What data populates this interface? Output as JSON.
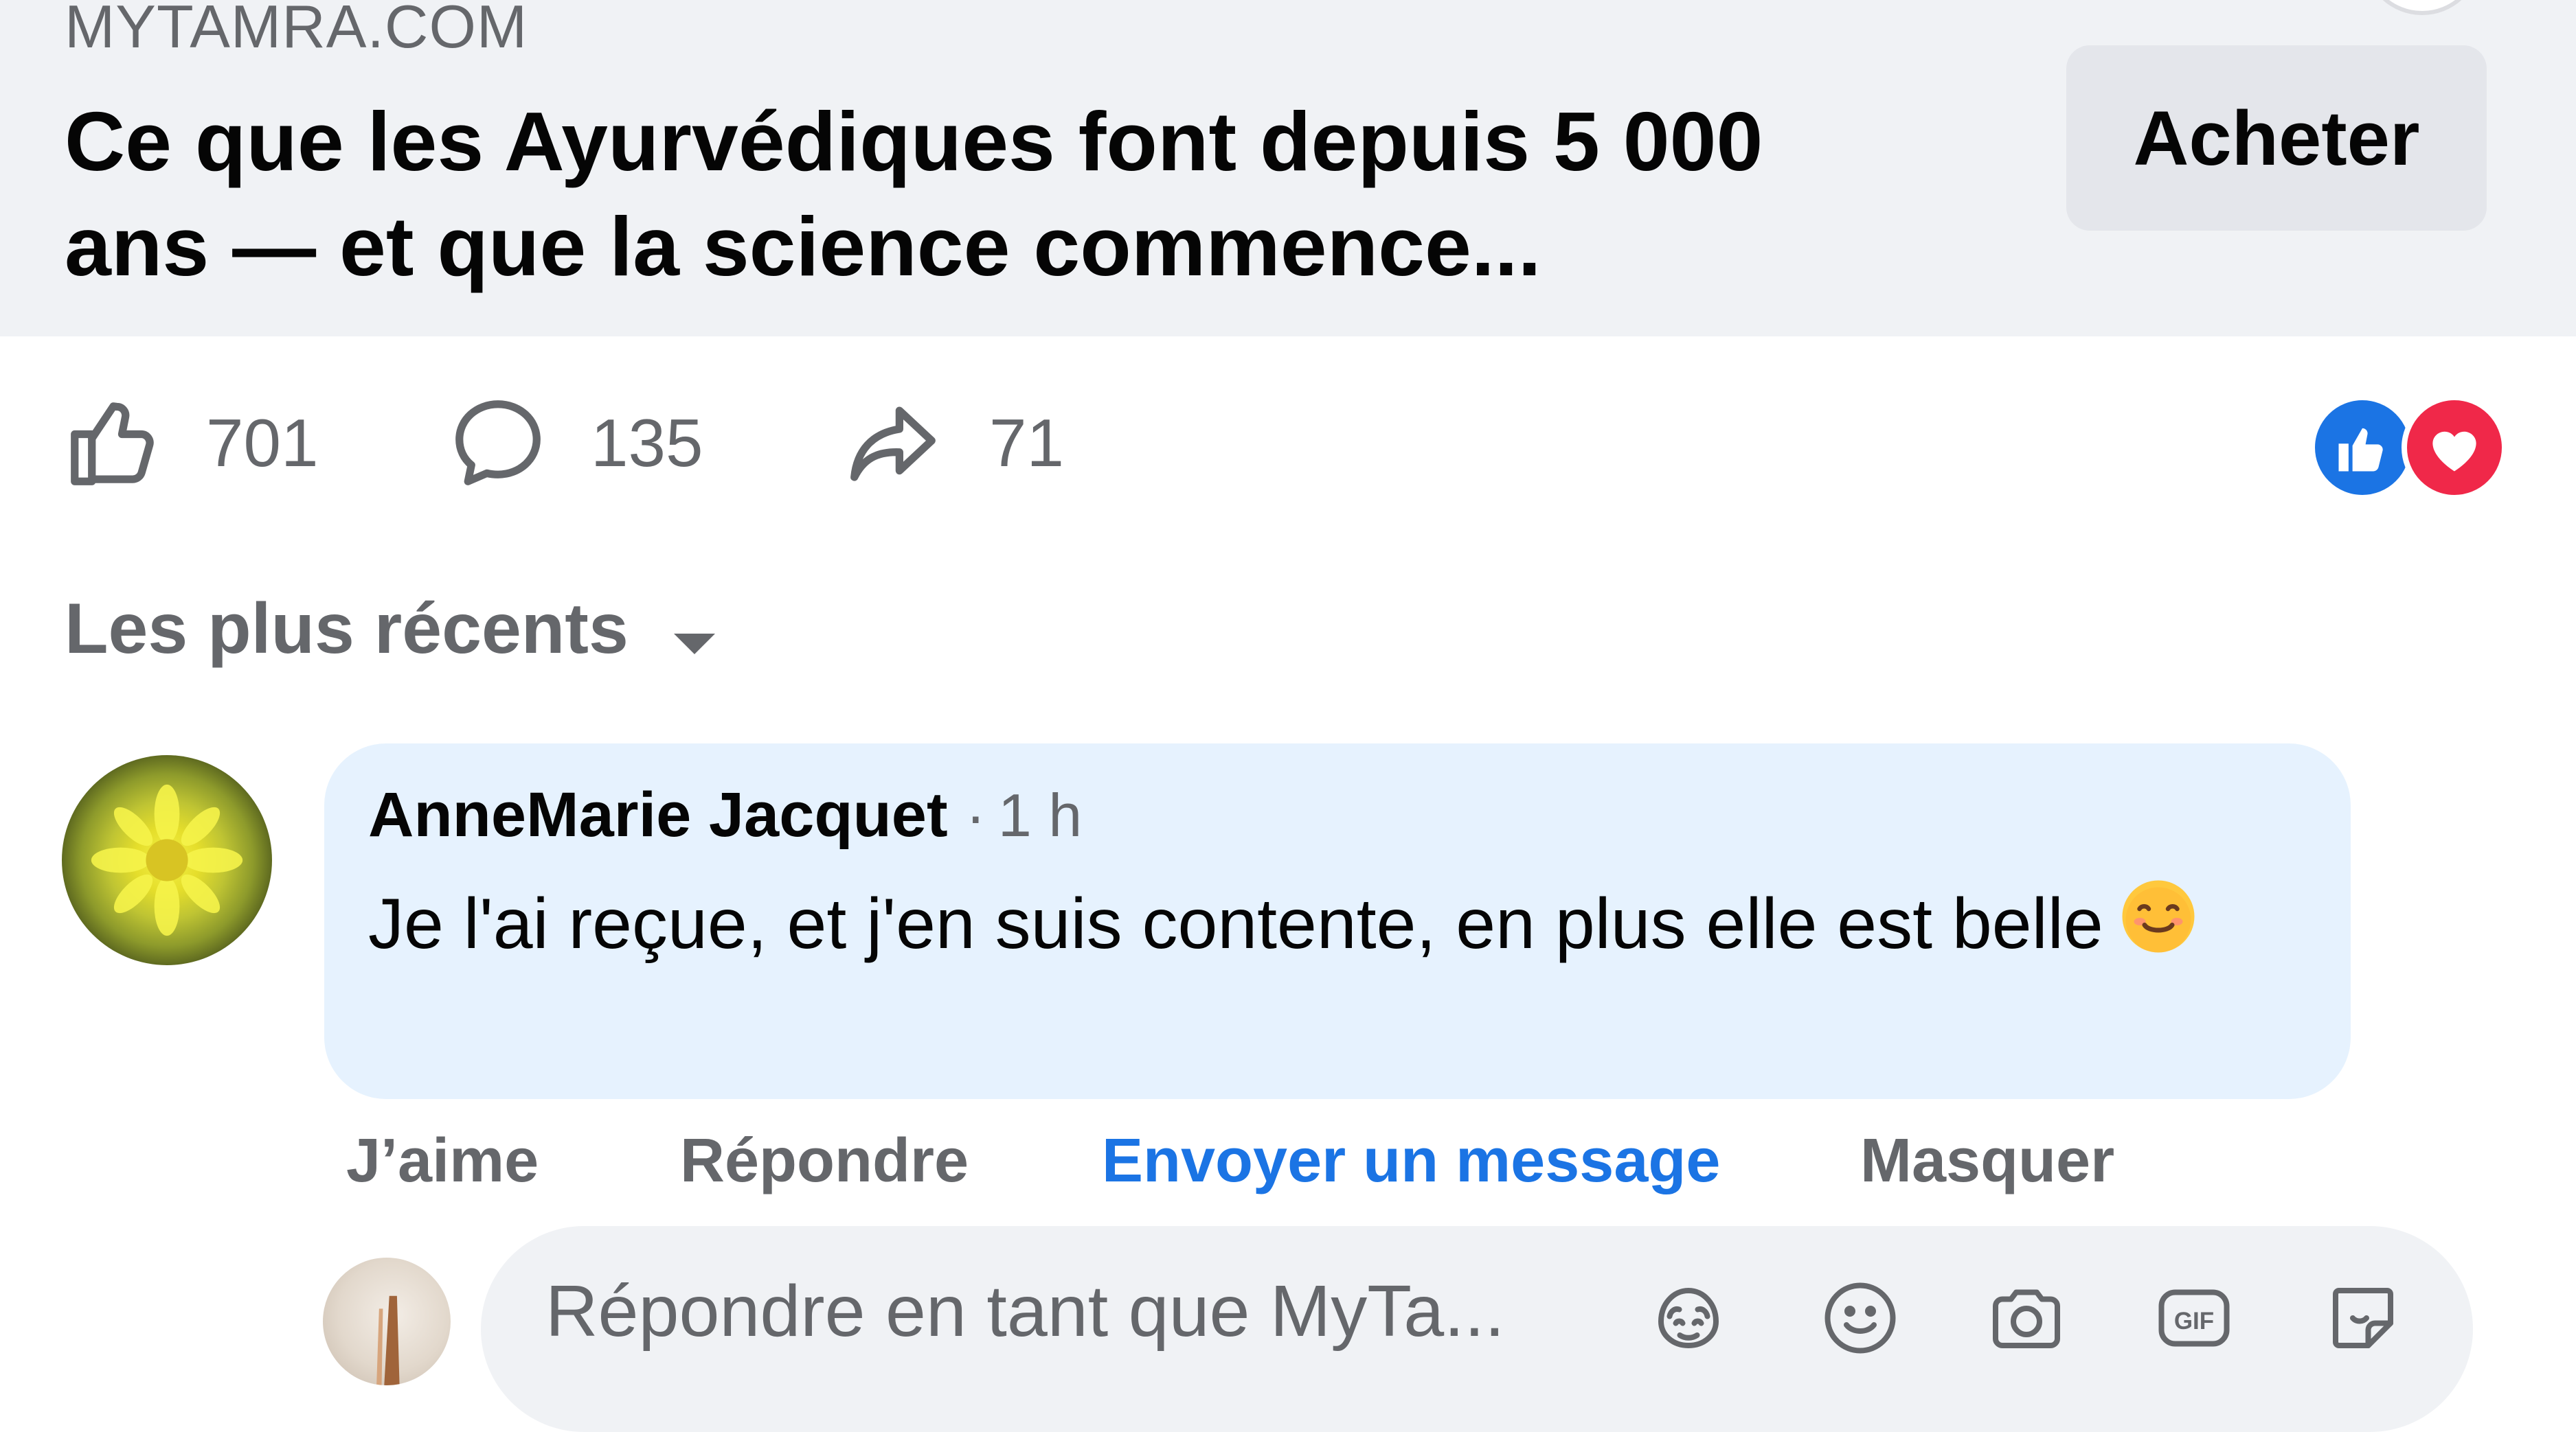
{
  "link": {
    "domain": "MYTAMRA.COM",
    "title": "Ce que les Ayurvédiques font depuis 5 000 ans — et que la science commence...",
    "buy_label": "Acheter"
  },
  "stats": {
    "likes": "701",
    "comments": "135",
    "shares": "71"
  },
  "reactions": [
    "like",
    "love"
  ],
  "sort": {
    "label": "Les plus récents"
  },
  "comment": {
    "author": "AnneMarie Jacquet",
    "separator": "·",
    "time": "1 h",
    "text": "Je l'ai reçue, et j'en suis contente, en plus elle est belle",
    "emoji": "smiling-face-icon"
  },
  "comment_actions": {
    "like": "J’aime",
    "reply": "Répondre",
    "message": "Envoyer un message",
    "hide": "Masquer"
  },
  "reply_input": {
    "placeholder": "Répondre en tant que MyTa..."
  },
  "colors": {
    "accent_blue": "#1b74e4",
    "love_red": "#f02849",
    "bubble_bg": "#e6f2fe",
    "muted_text": "#65676b"
  }
}
